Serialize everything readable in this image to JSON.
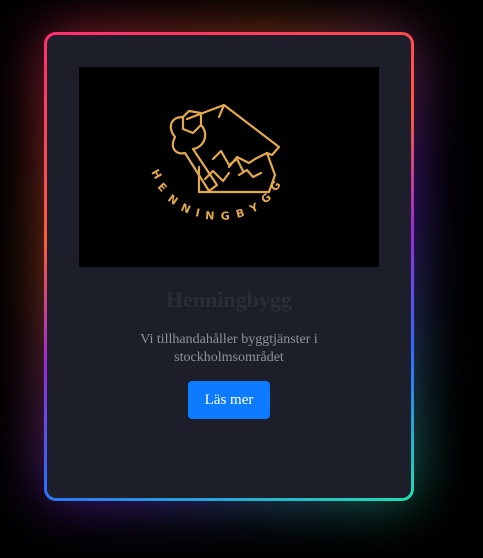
{
  "card": {
    "title": "Henningbygg",
    "description": "Vi tillhandahåller byggtjänster i stockholmsområdet",
    "button_label": "Läs mer"
  },
  "logo": {
    "text": "HENNINGBYGG",
    "icon": "wrench-house-logo-icon",
    "color": "#e3a94a"
  },
  "colors": {
    "background": "#000000",
    "card": "#1c1f2a",
    "accent": "#0d7bff",
    "border_gradient": [
      "#ff2d6f",
      "#ff5a3d",
      "#9a2bd8",
      "#2f6bff",
      "#1fe0b0"
    ]
  }
}
